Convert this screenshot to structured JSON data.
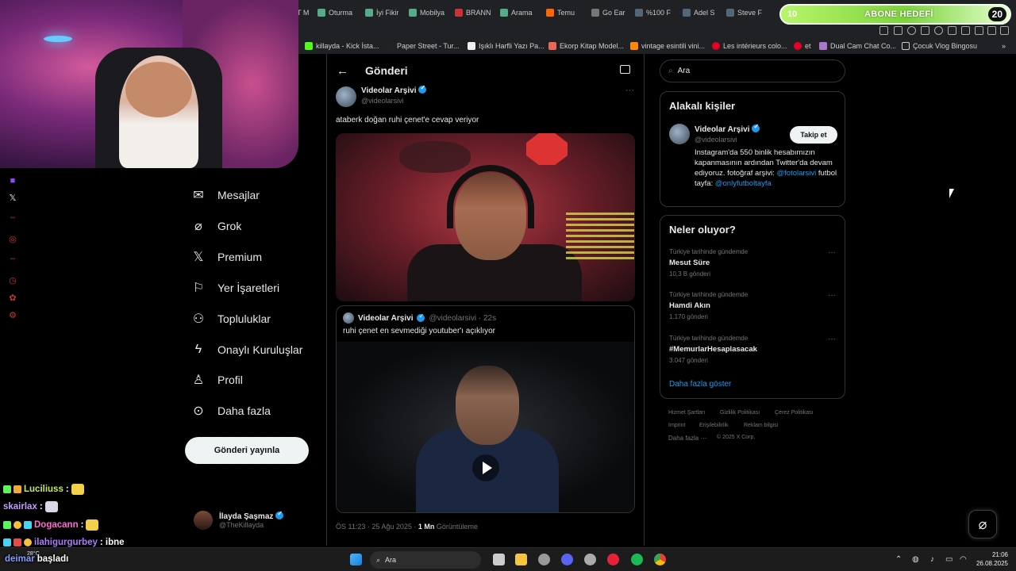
{
  "browser": {
    "tabs": [
      "T M",
      "Oturma",
      "İyi Fikir",
      "Mobilya",
      "BRANN",
      "Arama",
      "Temu",
      "Go Ear",
      "%100 F",
      "Adel S",
      "Steve F"
    ],
    "bookmarks": [
      "killayda - Kick İsta...",
      "Paper Street - Tur...",
      "Işıklı Harfli Yazı Pa...",
      "Ekorp Kitap Model...",
      "vintage esintili vini...",
      "Les intérieurs colo...",
      "et",
      "Dual Cam Chat Co...",
      "Çocuk Vlog Bingosu"
    ]
  },
  "goal": {
    "left": "10",
    "label": "ABONE HEDEFİ",
    "right": "20"
  },
  "nav": {
    "items": [
      "Mesajlar",
      "Grok",
      "Premium",
      "Yer İşaretleri",
      "Topluluklar",
      "Onaylı Kuruluşlar",
      "Profil",
      "Daha fazla"
    ],
    "post_button": "Gönderi yayınla",
    "me_name": "İlayda Şaşmaz",
    "me_handle": "@TheKillayda"
  },
  "post": {
    "header": "Gönderi",
    "author_name": "Videolar Arşivi",
    "author_handle": "@videolarsivi",
    "text": "ataberk doğan ruhi çenet'e cevap veriyor",
    "quote": {
      "name": "Videolar Arşivi",
      "handle": "@videolarsivi · 22s",
      "text": "ruhi çenet en sevmediği youtuber'ı açıklıyor"
    },
    "meta_time": "ÖS 11:23 · 25 Ağu 2025 · ",
    "meta_views": "1 Mn",
    "meta_suffix": " Görüntüleme"
  },
  "right": {
    "search_placeholder": "Ara",
    "related_title": "Alakalı kişiler",
    "related_name": "Videolar Arşivi",
    "related_handle": "@videolarsivi",
    "follow_label": "Takip et",
    "bio_1": "Instagram'da 550 binlik hesabımızın kapanmasının ardından Twitter'da devam ediyoruz. fotoğraf arşivi: ",
    "bio_link_1": "@fotolarsivi",
    "bio_2": " futbol tayfa: ",
    "bio_link_2": "@onlyfutboltayfa",
    "trends_title": "Neler oluyor?",
    "trends": [
      {
        "context": "Türkiye tarihinde gündemde",
        "name": "Mesut Süre",
        "count": "10,3 B gönderi"
      },
      {
        "context": "Türkiye tarihinde gündemde",
        "name": "Hamdi Akın",
        "count": "1.170 gönderi"
      },
      {
        "context": "Türkiye tarihinde gündemde",
        "name": "#MemurlarHesaplasacak",
        "count": "3.047 gönderi"
      }
    ],
    "show_more": "Daha fazla göster",
    "footer": [
      "Hizmet Şartları",
      "Gizlilik Politikası",
      "Çerez Politikası",
      "Imprint",
      "Erişilebilirlik",
      "Reklam bilgisi",
      "Daha fazla ···",
      "© 2025 X Corp."
    ]
  },
  "chat": [
    {
      "user": "Luciliuss",
      "msg": ":",
      "color": "#c6e86a"
    },
    {
      "user": "skairlax",
      "msg": ":",
      "color": "#c59bff"
    },
    {
      "user": "Dogacann",
      "msg": ":",
      "color": "#ff6bd0"
    },
    {
      "user": "ilahigurgurbey",
      "msg": ": ibne",
      "color": "#ae7bff"
    },
    {
      "user": "deimar",
      "msg": "başladı",
      "color": "#8a9bff"
    }
  ],
  "taskbar": {
    "search": "Ara",
    "weather": "28°C",
    "time": "21:06",
    "date": "26.08.2025"
  }
}
